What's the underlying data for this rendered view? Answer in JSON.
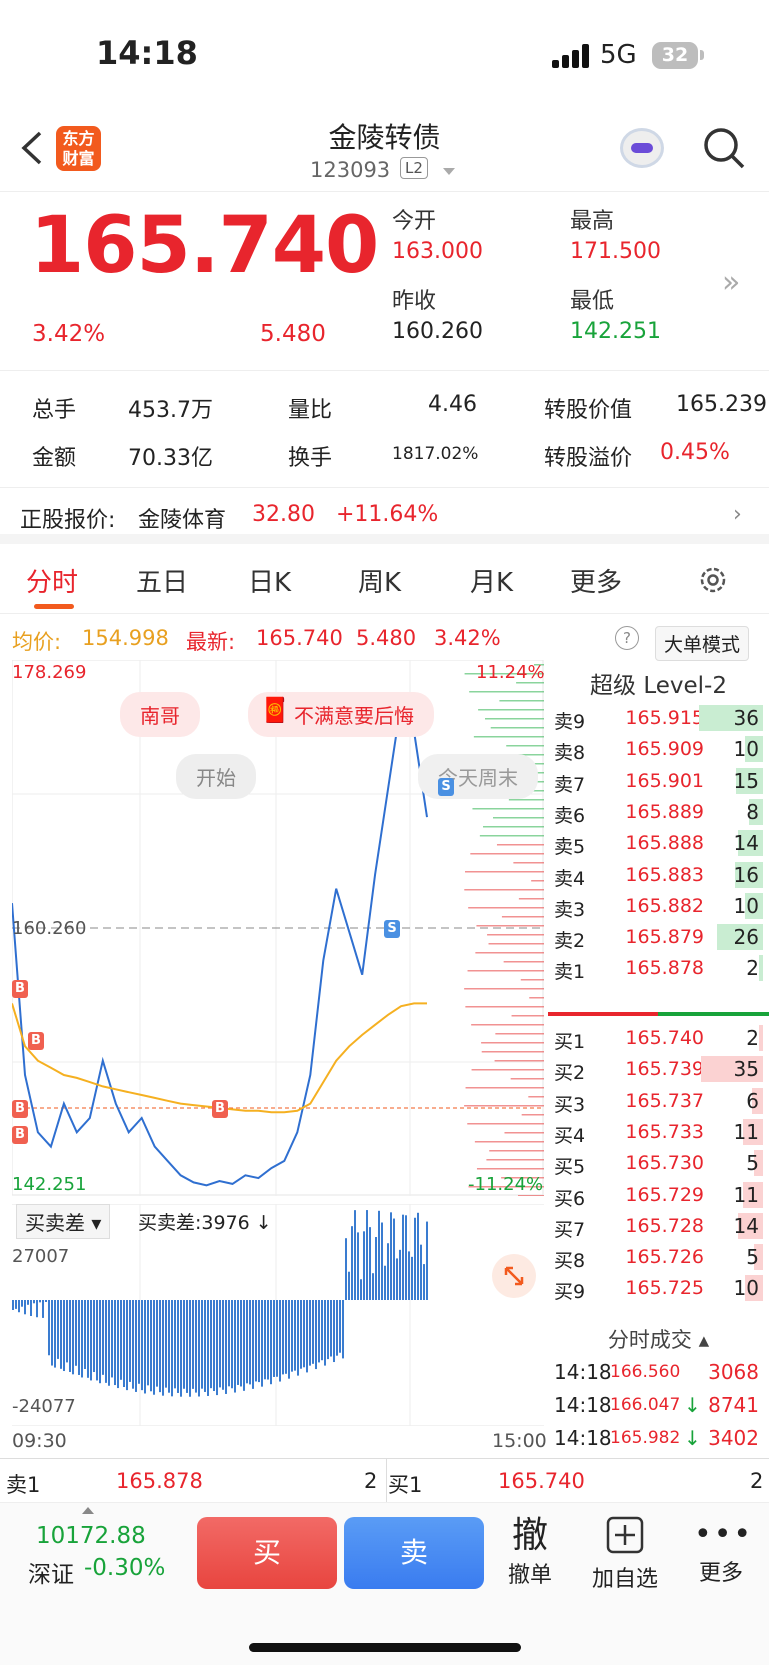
{
  "status": {
    "time": "14:18",
    "network": "5G",
    "battery": "32"
  },
  "nav": {
    "logo_line1": "东方",
    "logo_line2": "财富",
    "title": "金陵转债",
    "code": "123093",
    "level": "L2"
  },
  "quote": {
    "price": "165.740",
    "pct": "3.42%",
    "change": "5.480",
    "open_label": "今开",
    "open": "163.000",
    "high_label": "最高",
    "high": "171.500",
    "prev_label": "昨收",
    "prev": "160.260",
    "low_label": "最低",
    "low": "142.251"
  },
  "stats": {
    "vol_label": "总手",
    "vol": "453.7万",
    "ratio_label": "量比",
    "ratio": "4.46",
    "cv_label": "转股价值",
    "cv": "165.239",
    "amt_label": "金额",
    "amt": "70.33亿",
    "turn_label": "换手",
    "turn": "1817.02%",
    "prem_label": "转股溢价",
    "prem": "0.45%"
  },
  "stock": {
    "label": "正股报价:",
    "name": "金陵体育",
    "price": "32.80",
    "pct": "+11.64%"
  },
  "tabs": [
    "分时",
    "五日",
    "日K",
    "周K",
    "月K",
    "更多"
  ],
  "avgbar": {
    "avg_label": "均价:",
    "avg": "154.998",
    "last_label": "最新:",
    "last": "165.740",
    "chg": "5.480",
    "pct": "3.42%",
    "mode": "大单模式"
  },
  "chart": {
    "ymax": "178.269",
    "ymin": "142.251",
    "pmax": "11.24%",
    "pmin": "-11.24%",
    "mid": "160.260",
    "t_start": "09:30",
    "t_end": "15:00",
    "bubbles": [
      "南哥",
      "不满意要后悔",
      "开始",
      "今天周末"
    ],
    "sub_title": "买卖差",
    "sub_value": "买卖差:3976 ↓",
    "sub_max": "27007",
    "sub_min": "-24077"
  },
  "chart_data": {
    "type": "line",
    "title": "",
    "series": [
      {
        "name": "",
        "values": [
          162,
          150,
          146,
          145,
          148,
          146,
          147,
          151,
          148,
          146,
          147,
          145,
          144,
          143,
          142.5,
          142.3,
          142.6,
          142.4,
          143,
          142.8,
          143.5,
          144,
          146,
          150,
          158,
          163,
          160,
          157,
          164,
          170,
          176,
          174,
          168
        ]
      },
      {
        "name": "均价",
        "values": [
          155,
          152,
          151,
          150.5,
          150,
          149.8,
          149.5,
          149.2,
          149,
          148.8,
          148.6,
          148.4,
          148.2,
          148,
          147.9,
          147.8,
          147.7,
          147.6,
          147.5,
          147.5,
          147.4,
          147.4,
          147.5,
          148,
          149.5,
          151,
          152,
          152.8,
          153.5,
          154.2,
          154.8,
          155,
          155
        ]
      }
    ],
    "ylim": [
      142.251,
      178.269
    ]
  },
  "orderbook": {
    "title": "超级 Level-2",
    "sells": [
      {
        "l": "卖9",
        "p": "165.915",
        "v": "36"
      },
      {
        "l": "卖8",
        "p": "165.909",
        "v": "10"
      },
      {
        "l": "卖7",
        "p": "165.901",
        "v": "15"
      },
      {
        "l": "卖6",
        "p": "165.889",
        "v": "8"
      },
      {
        "l": "卖5",
        "p": "165.888",
        "v": "14"
      },
      {
        "l": "卖4",
        "p": "165.883",
        "v": "16"
      },
      {
        "l": "卖3",
        "p": "165.882",
        "v": "10"
      },
      {
        "l": "卖2",
        "p": "165.879",
        "v": "26"
      },
      {
        "l": "卖1",
        "p": "165.878",
        "v": "2"
      }
    ],
    "buys": [
      {
        "l": "买1",
        "p": "165.740",
        "v": "2"
      },
      {
        "l": "买2",
        "p": "165.739",
        "v": "35"
      },
      {
        "l": "买3",
        "p": "165.737",
        "v": "6"
      },
      {
        "l": "买4",
        "p": "165.733",
        "v": "11"
      },
      {
        "l": "买5",
        "p": "165.730",
        "v": "5"
      },
      {
        "l": "买6",
        "p": "165.729",
        "v": "11"
      },
      {
        "l": "买7",
        "p": "165.728",
        "v": "14"
      },
      {
        "l": "买8",
        "p": "165.726",
        "v": "5"
      },
      {
        "l": "买9",
        "p": "165.725",
        "v": "10"
      }
    ]
  },
  "ticks": {
    "title": "分时成交",
    "rows": [
      {
        "t": "14:18",
        "p": "166.560",
        "v": "3068"
      },
      {
        "t": "14:18",
        "p": "166.047",
        "v": "8741"
      },
      {
        "t": "14:18",
        "p": "165.982",
        "v": "3402"
      }
    ]
  },
  "bottomq": {
    "s1": "卖1",
    "s1p": "165.878",
    "s1v": "2",
    "b1": "买1",
    "b1p": "165.740",
    "b1v": "2"
  },
  "toolbar": {
    "index": "10172.88",
    "index_name": "深证",
    "index_pct": "-0.30%",
    "buy": "买",
    "sell": "卖",
    "cancel_icon": "撤",
    "cancel": "撤单",
    "add": "加自选",
    "more": "更多"
  }
}
